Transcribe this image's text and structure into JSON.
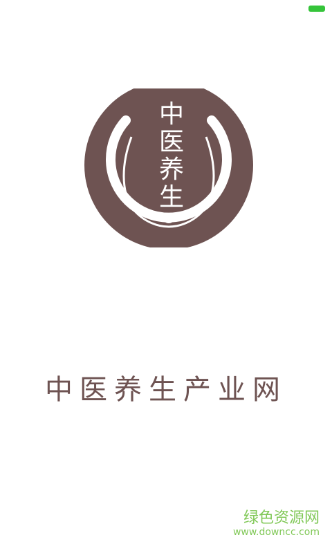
{
  "status_bar": {
    "battery_color": "#35c43a",
    "battery_icon": "battery-icon"
  },
  "logo": {
    "title": "中医养生",
    "color": "#6e5352"
  },
  "site_name": "中医养生产业网",
  "watermark": {
    "main": "绿色资源网",
    "url": "www.downcc.com",
    "color": "#6bbf3a"
  }
}
